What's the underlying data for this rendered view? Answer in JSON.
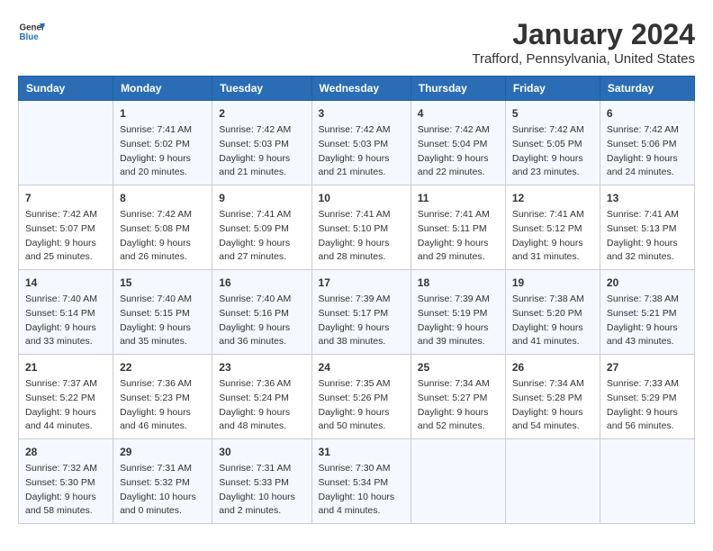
{
  "header": {
    "logo_line1": "General",
    "logo_line2": "Blue",
    "month": "January 2024",
    "location": "Trafford, Pennsylvania, United States"
  },
  "days_of_week": [
    "Sunday",
    "Monday",
    "Tuesday",
    "Wednesday",
    "Thursday",
    "Friday",
    "Saturday"
  ],
  "weeks": [
    [
      {
        "day": "",
        "data": ""
      },
      {
        "day": "1",
        "data": "Sunrise: 7:41 AM\nSunset: 5:02 PM\nDaylight: 9 hours\nand 20 minutes."
      },
      {
        "day": "2",
        "data": "Sunrise: 7:42 AM\nSunset: 5:03 PM\nDaylight: 9 hours\nand 21 minutes."
      },
      {
        "day": "3",
        "data": "Sunrise: 7:42 AM\nSunset: 5:03 PM\nDaylight: 9 hours\nand 21 minutes."
      },
      {
        "day": "4",
        "data": "Sunrise: 7:42 AM\nSunset: 5:04 PM\nDaylight: 9 hours\nand 22 minutes."
      },
      {
        "day": "5",
        "data": "Sunrise: 7:42 AM\nSunset: 5:05 PM\nDaylight: 9 hours\nand 23 minutes."
      },
      {
        "day": "6",
        "data": "Sunrise: 7:42 AM\nSunset: 5:06 PM\nDaylight: 9 hours\nand 24 minutes."
      }
    ],
    [
      {
        "day": "7",
        "data": "Sunrise: 7:42 AM\nSunset: 5:07 PM\nDaylight: 9 hours\nand 25 minutes."
      },
      {
        "day": "8",
        "data": "Sunrise: 7:42 AM\nSunset: 5:08 PM\nDaylight: 9 hours\nand 26 minutes."
      },
      {
        "day": "9",
        "data": "Sunrise: 7:41 AM\nSunset: 5:09 PM\nDaylight: 9 hours\nand 27 minutes."
      },
      {
        "day": "10",
        "data": "Sunrise: 7:41 AM\nSunset: 5:10 PM\nDaylight: 9 hours\nand 28 minutes."
      },
      {
        "day": "11",
        "data": "Sunrise: 7:41 AM\nSunset: 5:11 PM\nDaylight: 9 hours\nand 29 minutes."
      },
      {
        "day": "12",
        "data": "Sunrise: 7:41 AM\nSunset: 5:12 PM\nDaylight: 9 hours\nand 31 minutes."
      },
      {
        "day": "13",
        "data": "Sunrise: 7:41 AM\nSunset: 5:13 PM\nDaylight: 9 hours\nand 32 minutes."
      }
    ],
    [
      {
        "day": "14",
        "data": "Sunrise: 7:40 AM\nSunset: 5:14 PM\nDaylight: 9 hours\nand 33 minutes."
      },
      {
        "day": "15",
        "data": "Sunrise: 7:40 AM\nSunset: 5:15 PM\nDaylight: 9 hours\nand 35 minutes."
      },
      {
        "day": "16",
        "data": "Sunrise: 7:40 AM\nSunset: 5:16 PM\nDaylight: 9 hours\nand 36 minutes."
      },
      {
        "day": "17",
        "data": "Sunrise: 7:39 AM\nSunset: 5:17 PM\nDaylight: 9 hours\nand 38 minutes."
      },
      {
        "day": "18",
        "data": "Sunrise: 7:39 AM\nSunset: 5:19 PM\nDaylight: 9 hours\nand 39 minutes."
      },
      {
        "day": "19",
        "data": "Sunrise: 7:38 AM\nSunset: 5:20 PM\nDaylight: 9 hours\nand 41 minutes."
      },
      {
        "day": "20",
        "data": "Sunrise: 7:38 AM\nSunset: 5:21 PM\nDaylight: 9 hours\nand 43 minutes."
      }
    ],
    [
      {
        "day": "21",
        "data": "Sunrise: 7:37 AM\nSunset: 5:22 PM\nDaylight: 9 hours\nand 44 minutes."
      },
      {
        "day": "22",
        "data": "Sunrise: 7:36 AM\nSunset: 5:23 PM\nDaylight: 9 hours\nand 46 minutes."
      },
      {
        "day": "23",
        "data": "Sunrise: 7:36 AM\nSunset: 5:24 PM\nDaylight: 9 hours\nand 48 minutes."
      },
      {
        "day": "24",
        "data": "Sunrise: 7:35 AM\nSunset: 5:26 PM\nDaylight: 9 hours\nand 50 minutes."
      },
      {
        "day": "25",
        "data": "Sunrise: 7:34 AM\nSunset: 5:27 PM\nDaylight: 9 hours\nand 52 minutes."
      },
      {
        "day": "26",
        "data": "Sunrise: 7:34 AM\nSunset: 5:28 PM\nDaylight: 9 hours\nand 54 minutes."
      },
      {
        "day": "27",
        "data": "Sunrise: 7:33 AM\nSunset: 5:29 PM\nDaylight: 9 hours\nand 56 minutes."
      }
    ],
    [
      {
        "day": "28",
        "data": "Sunrise: 7:32 AM\nSunset: 5:30 PM\nDaylight: 9 hours\nand 58 minutes."
      },
      {
        "day": "29",
        "data": "Sunrise: 7:31 AM\nSunset: 5:32 PM\nDaylight: 10 hours\nand 0 minutes."
      },
      {
        "day": "30",
        "data": "Sunrise: 7:31 AM\nSunset: 5:33 PM\nDaylight: 10 hours\nand 2 minutes."
      },
      {
        "day": "31",
        "data": "Sunrise: 7:30 AM\nSunset: 5:34 PM\nDaylight: 10 hours\nand 4 minutes."
      },
      {
        "day": "",
        "data": ""
      },
      {
        "day": "",
        "data": ""
      },
      {
        "day": "",
        "data": ""
      }
    ]
  ]
}
